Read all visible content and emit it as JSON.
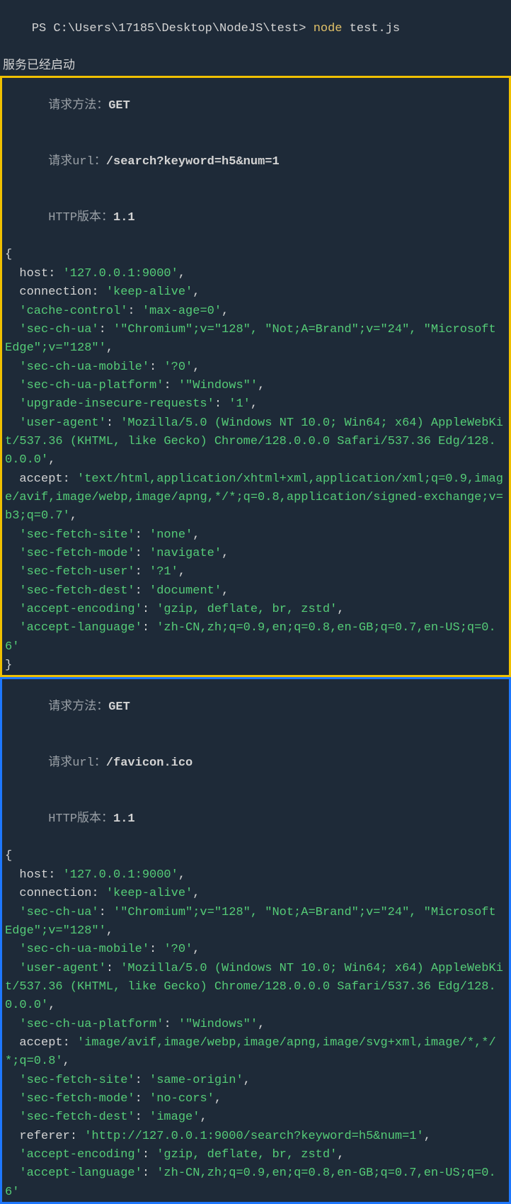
{
  "prompt": {
    "prefix": "PS ",
    "path": "C:\\Users\\17185\\Desktop\\NodeJS\\test>",
    "cmd": "node",
    "arg": "test.js"
  },
  "startup": "服务已经启动",
  "request1": {
    "method_label": "请求方法：",
    "method_value": "GET",
    "url_label": "请求url：",
    "url_value": "/search?keyword=h5&num=1",
    "http_label": "HTTP版本：",
    "http_value": "1.1",
    "headers": [
      {
        "key": "host",
        "quoted": false,
        "value": "'127.0.0.1:9000'"
      },
      {
        "key": "connection",
        "quoted": false,
        "value": "'keep-alive'"
      },
      {
        "key": "'cache-control'",
        "quoted": true,
        "value": "'max-age=0'"
      },
      {
        "key": "'sec-ch-ua'",
        "quoted": true,
        "value": "'\"Chromium\";v=\"128\", \"Not;A=Brand\";v=\"24\", \"Microsoft Edge\";v=\"128\"'"
      },
      {
        "key": "'sec-ch-ua-mobile'",
        "quoted": true,
        "value": "'?0'"
      },
      {
        "key": "'sec-ch-ua-platform'",
        "quoted": true,
        "value": "'\"Windows\"'"
      },
      {
        "key": "'upgrade-insecure-requests'",
        "quoted": true,
        "value": "'1'"
      },
      {
        "key": "'user-agent'",
        "quoted": true,
        "value": "'Mozilla/5.0 (Windows NT 10.0; Win64; x64) AppleWebKit/537.36 (KHTML, like Gecko) Chrome/128.0.0.0 Safari/537.36 Edg/128.0.0.0'"
      },
      {
        "key": "accept",
        "quoted": false,
        "value": "'text/html,application/xhtml+xml,application/xml;q=0.9,image/avif,image/webp,image/apng,*/*;q=0.8,application/signed-exchange;v=b3;q=0.7'"
      },
      {
        "key": "'sec-fetch-site'",
        "quoted": true,
        "value": "'none'"
      },
      {
        "key": "'sec-fetch-mode'",
        "quoted": true,
        "value": "'navigate'"
      },
      {
        "key": "'sec-fetch-user'",
        "quoted": true,
        "value": "'?1'"
      },
      {
        "key": "'sec-fetch-dest'",
        "quoted": true,
        "value": "'document'"
      },
      {
        "key": "'accept-encoding'",
        "quoted": true,
        "value": "'gzip, deflate, br, zstd'"
      },
      {
        "key": "'accept-language'",
        "quoted": true,
        "value": "'zh-CN,zh;q=0.9,en;q=0.8,en-GB;q=0.7,en-US;q=0.6'",
        "last": true
      }
    ]
  },
  "request2": {
    "method_label": "请求方法：",
    "method_value": "GET",
    "url_label": "请求url：",
    "url_value": "/favicon.ico",
    "http_label": "HTTP版本：",
    "http_value": "1.1",
    "headers": [
      {
        "key": "host",
        "quoted": false,
        "value": "'127.0.0.1:9000'"
      },
      {
        "key": "connection",
        "quoted": false,
        "value": "'keep-alive'"
      },
      {
        "key": "'sec-ch-ua'",
        "quoted": true,
        "value": "'\"Chromium\";v=\"128\", \"Not;A=Brand\";v=\"24\", \"Microsoft Edge\";v=\"128\"'"
      },
      {
        "key": "'sec-ch-ua-mobile'",
        "quoted": true,
        "value": "'?0'"
      },
      {
        "key": "'user-agent'",
        "quoted": true,
        "value": "'Mozilla/5.0 (Windows NT 10.0; Win64; x64) AppleWebKit/537.36 (KHTML, like Gecko) Chrome/128.0.0.0 Safari/537.36 Edg/128.0.0.0'"
      },
      {
        "key": "'sec-ch-ua-platform'",
        "quoted": true,
        "value": "'\"Windows\"'"
      },
      {
        "key": "accept",
        "quoted": false,
        "value": "'image/avif,image/webp,image/apng,image/svg+xml,image/*,*/*;q=0.8'"
      },
      {
        "key": "'sec-fetch-site'",
        "quoted": true,
        "value": "'same-origin'"
      },
      {
        "key": "'sec-fetch-mode'",
        "quoted": true,
        "value": "'no-cors'"
      },
      {
        "key": "'sec-fetch-dest'",
        "quoted": true,
        "value": "'image'"
      },
      {
        "key": "referer",
        "quoted": false,
        "value": "'http://127.0.0.1:9000/search?keyword=h5&num=1'"
      },
      {
        "key": "'accept-encoding'",
        "quoted": true,
        "value": "'gzip, deflate, br, zstd'"
      },
      {
        "key": "'accept-language'",
        "quoted": true,
        "value": "'zh-CN,zh;q=0.9,en;q=0.8,en-GB;q=0.7,en-US;q=0.6'",
        "last": true
      }
    ]
  }
}
